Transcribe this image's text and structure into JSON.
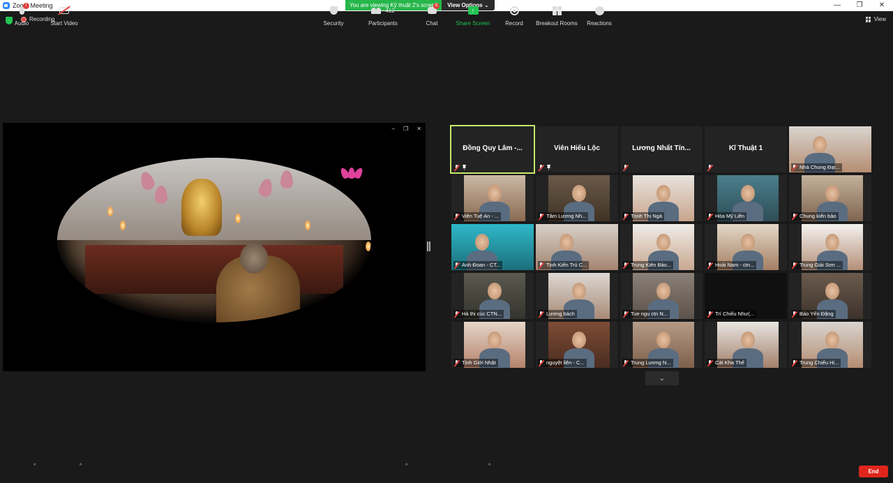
{
  "window": {
    "title": "Zoom Meeting",
    "minimize": "—",
    "maximize": "❐",
    "close": "✕"
  },
  "banner": {
    "viewing": "You are viewing Kỹ thuật 2's screen",
    "view_options": "View Options ⌄"
  },
  "status": {
    "recording": "Recording",
    "view": "View"
  },
  "share_controls": {
    "min": "–",
    "restore": "❐",
    "close": "✕"
  },
  "tiles": [
    {
      "name": "Đồng Quy Lâm -...",
      "type": "name"
    },
    {
      "name": "Viên Hiếu Lộc",
      "type": "name"
    },
    {
      "name": "Lương Nhất Tín...",
      "type": "name"
    },
    {
      "name": "Kĩ Thuật 1",
      "type": "name"
    },
    {
      "name": "Nhà Chung Đại...",
      "type": "video"
    },
    {
      "name": "Viên Tuệ An - ...",
      "type": "video"
    },
    {
      "name": "Tâm Lương Nh...",
      "type": "video"
    },
    {
      "name": "Trịnh Thị Ngà",
      "type": "video"
    },
    {
      "name": "Hòa Mỹ Liên",
      "type": "video"
    },
    {
      "name": "Chung kiến bảo",
      "type": "video"
    },
    {
      "name": "Anh Đoan - CT...",
      "type": "video"
    },
    {
      "name": "Tịnh Kiến Trú C...",
      "type": "video"
    },
    {
      "name": "Trung Kiên Bảo...",
      "type": "video"
    },
    {
      "name": "Hoài Nam - ctn...",
      "type": "video"
    },
    {
      "name": "Trung Giải Sơn ...",
      "type": "video"
    },
    {
      "name": "Hà thi cúc CTN...",
      "type": "video"
    },
    {
      "name": "Lương bách",
      "type": "video"
    },
    {
      "name": "Tue ngu ctn N...",
      "type": "video"
    },
    {
      "name": "Trí Chiếu Như(...",
      "type": "video"
    },
    {
      "name": "Bảo Yến Đặng",
      "type": "video"
    },
    {
      "name": "Tịnh Giới Nhật",
      "type": "video"
    },
    {
      "name": "nguyệt liên - C...",
      "type": "video"
    },
    {
      "name": "Trung Lương N...",
      "type": "video"
    },
    {
      "name": "Cát Kha Thế",
      "type": "video"
    },
    {
      "name": "Trung Chiếu Hi...",
      "type": "video"
    }
  ],
  "toolbar": {
    "audio": "Audio",
    "audio_badge": "!",
    "start_video": "Start Video",
    "security": "Security",
    "participants": "Participants",
    "participants_count": "412",
    "chat": "Chat",
    "chat_badge": "5",
    "share_screen": "Share Screen",
    "record": "Record",
    "breakout_rooms": "Breakout Rooms",
    "reactions": "Reactions",
    "end": "End"
  },
  "colors": {
    "active_speaker": "#c7e86a",
    "share_green": "#26b64a",
    "end_red": "#e0261c",
    "mute_red": "#e0443f"
  }
}
